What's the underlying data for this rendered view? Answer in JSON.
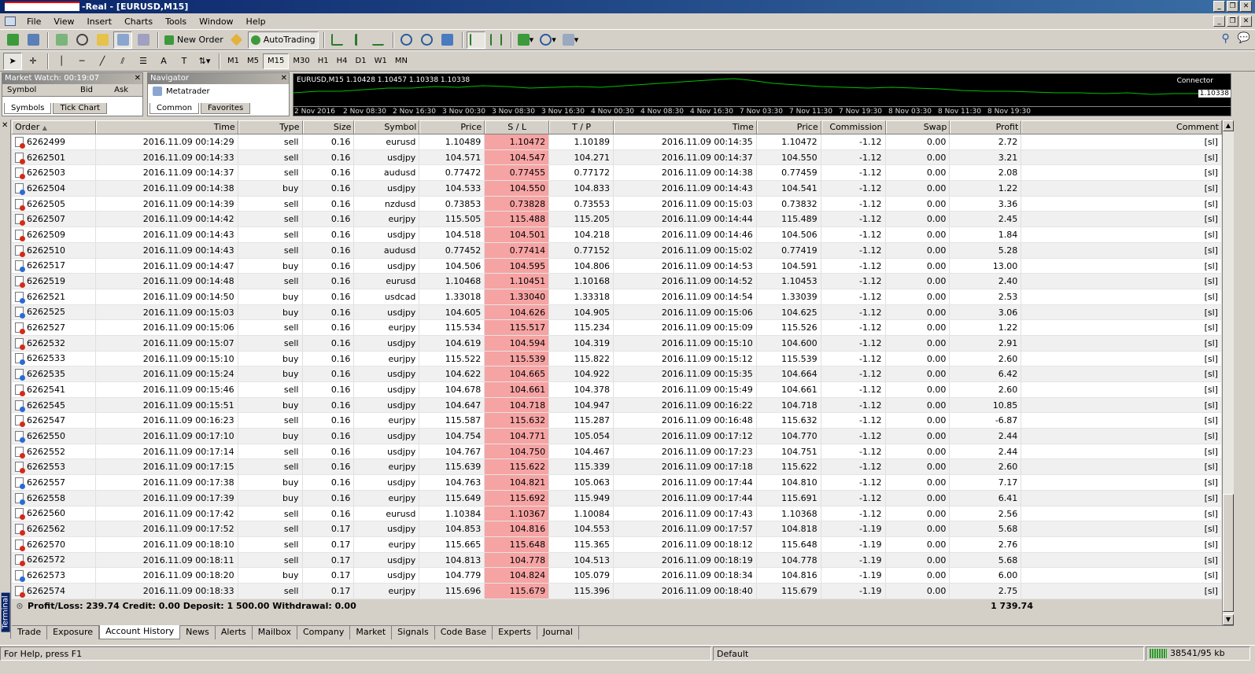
{
  "window": {
    "title": "-Real - [EURUSD,M15]"
  },
  "menu": [
    "File",
    "View",
    "Insert",
    "Charts",
    "Tools",
    "Window",
    "Help"
  ],
  "toolbar": {
    "new_order": "New Order",
    "autotrading": "AutoTrading"
  },
  "timeframes": [
    "M1",
    "M5",
    "M15",
    "M30",
    "H1",
    "H4",
    "D1",
    "W1",
    "MN"
  ],
  "active_timeframe": "M15",
  "market_watch": {
    "title": "Market Watch: 00:19:07",
    "cols": [
      "Symbol",
      "Bid",
      "Ask"
    ],
    "tabs": [
      "Symbols",
      "Tick Chart"
    ]
  },
  "navigator": {
    "title": "Navigator",
    "root": "Metatrader",
    "tabs": [
      "Common",
      "Favorites"
    ]
  },
  "chart": {
    "title": "EURUSD,M15  1.10428 1.10457 1.10338 1.10338",
    "connector": "Connector",
    "price": "1.10338",
    "ticks": [
      "2 Nov 2016",
      "2 Nov 08:30",
      "2 Nov 16:30",
      "3 Nov 00:30",
      "3 Nov 08:30",
      "3 Nov 16:30",
      "4 Nov 00:30",
      "4 Nov 08:30",
      "4 Nov 16:30",
      "7 Nov 03:30",
      "7 Nov 11:30",
      "7 Nov 19:30",
      "8 Nov 03:30",
      "8 Nov 11:30",
      "8 Nov 19:30"
    ]
  },
  "table": {
    "headers": [
      "Order",
      "Time",
      "Type",
      "Size",
      "Symbol",
      "Price",
      "S / L",
      "T / P",
      "Time",
      "Price",
      "Commission",
      "Swap",
      "Profit",
      "Comment"
    ],
    "rows": [
      [
        "6262499",
        "2016.11.09 00:14:29",
        "sell",
        "0.16",
        "eurusd",
        "1.10489",
        "1.10472",
        "1.10189",
        "2016.11.09 00:14:35",
        "1.10472",
        "-1.12",
        "0.00",
        "2.72",
        "[sl]"
      ],
      [
        "6262501",
        "2016.11.09 00:14:33",
        "sell",
        "0.16",
        "usdjpy",
        "104.571",
        "104.547",
        "104.271",
        "2016.11.09 00:14:37",
        "104.550",
        "-1.12",
        "0.00",
        "3.21",
        "[sl]"
      ],
      [
        "6262503",
        "2016.11.09 00:14:37",
        "sell",
        "0.16",
        "audusd",
        "0.77472",
        "0.77455",
        "0.77172",
        "2016.11.09 00:14:38",
        "0.77459",
        "-1.12",
        "0.00",
        "2.08",
        "[sl]"
      ],
      [
        "6262504",
        "2016.11.09 00:14:38",
        "buy",
        "0.16",
        "usdjpy",
        "104.533",
        "104.550",
        "104.833",
        "2016.11.09 00:14:43",
        "104.541",
        "-1.12",
        "0.00",
        "1.22",
        "[sl]"
      ],
      [
        "6262505",
        "2016.11.09 00:14:39",
        "sell",
        "0.16",
        "nzdusd",
        "0.73853",
        "0.73828",
        "0.73553",
        "2016.11.09 00:15:03",
        "0.73832",
        "-1.12",
        "0.00",
        "3.36",
        "[sl]"
      ],
      [
        "6262507",
        "2016.11.09 00:14:42",
        "sell",
        "0.16",
        "eurjpy",
        "115.505",
        "115.488",
        "115.205",
        "2016.11.09 00:14:44",
        "115.489",
        "-1.12",
        "0.00",
        "2.45",
        "[sl]"
      ],
      [
        "6262509",
        "2016.11.09 00:14:43",
        "sell",
        "0.16",
        "usdjpy",
        "104.518",
        "104.501",
        "104.218",
        "2016.11.09 00:14:46",
        "104.506",
        "-1.12",
        "0.00",
        "1.84",
        "[sl]"
      ],
      [
        "6262510",
        "2016.11.09 00:14:43",
        "sell",
        "0.16",
        "audusd",
        "0.77452",
        "0.77414",
        "0.77152",
        "2016.11.09 00:15:02",
        "0.77419",
        "-1.12",
        "0.00",
        "5.28",
        "[sl]"
      ],
      [
        "6262517",
        "2016.11.09 00:14:47",
        "buy",
        "0.16",
        "usdjpy",
        "104.506",
        "104.595",
        "104.806",
        "2016.11.09 00:14:53",
        "104.591",
        "-1.12",
        "0.00",
        "13.00",
        "[sl]"
      ],
      [
        "6262519",
        "2016.11.09 00:14:48",
        "sell",
        "0.16",
        "eurusd",
        "1.10468",
        "1.10451",
        "1.10168",
        "2016.11.09 00:14:52",
        "1.10453",
        "-1.12",
        "0.00",
        "2.40",
        "[sl]"
      ],
      [
        "6262521",
        "2016.11.09 00:14:50",
        "buy",
        "0.16",
        "usdcad",
        "1.33018",
        "1.33040",
        "1.33318",
        "2016.11.09 00:14:54",
        "1.33039",
        "-1.12",
        "0.00",
        "2.53",
        "[sl]"
      ],
      [
        "6262525",
        "2016.11.09 00:15:03",
        "buy",
        "0.16",
        "usdjpy",
        "104.605",
        "104.626",
        "104.905",
        "2016.11.09 00:15:06",
        "104.625",
        "-1.12",
        "0.00",
        "3.06",
        "[sl]"
      ],
      [
        "6262527",
        "2016.11.09 00:15:06",
        "sell",
        "0.16",
        "eurjpy",
        "115.534",
        "115.517",
        "115.234",
        "2016.11.09 00:15:09",
        "115.526",
        "-1.12",
        "0.00",
        "1.22",
        "[sl]"
      ],
      [
        "6262532",
        "2016.11.09 00:15:07",
        "sell",
        "0.16",
        "usdjpy",
        "104.619",
        "104.594",
        "104.319",
        "2016.11.09 00:15:10",
        "104.600",
        "-1.12",
        "0.00",
        "2.91",
        "[sl]"
      ],
      [
        "6262533",
        "2016.11.09 00:15:10",
        "buy",
        "0.16",
        "eurjpy",
        "115.522",
        "115.539",
        "115.822",
        "2016.11.09 00:15:12",
        "115.539",
        "-1.12",
        "0.00",
        "2.60",
        "[sl]"
      ],
      [
        "6262535",
        "2016.11.09 00:15:24",
        "buy",
        "0.16",
        "usdjpy",
        "104.622",
        "104.665",
        "104.922",
        "2016.11.09 00:15:35",
        "104.664",
        "-1.12",
        "0.00",
        "6.42",
        "[sl]"
      ],
      [
        "6262541",
        "2016.11.09 00:15:46",
        "sell",
        "0.16",
        "usdjpy",
        "104.678",
        "104.661",
        "104.378",
        "2016.11.09 00:15:49",
        "104.661",
        "-1.12",
        "0.00",
        "2.60",
        "[sl]"
      ],
      [
        "6262545",
        "2016.11.09 00:15:51",
        "buy",
        "0.16",
        "usdjpy",
        "104.647",
        "104.718",
        "104.947",
        "2016.11.09 00:16:22",
        "104.718",
        "-1.12",
        "0.00",
        "10.85",
        "[sl]"
      ],
      [
        "6262547",
        "2016.11.09 00:16:23",
        "sell",
        "0.16",
        "eurjpy",
        "115.587",
        "115.632",
        "115.287",
        "2016.11.09 00:16:48",
        "115.632",
        "-1.12",
        "0.00",
        "-6.87",
        "[sl]"
      ],
      [
        "6262550",
        "2016.11.09 00:17:10",
        "buy",
        "0.16",
        "usdjpy",
        "104.754",
        "104.771",
        "105.054",
        "2016.11.09 00:17:12",
        "104.770",
        "-1.12",
        "0.00",
        "2.44",
        "[sl]"
      ],
      [
        "6262552",
        "2016.11.09 00:17:14",
        "sell",
        "0.16",
        "usdjpy",
        "104.767",
        "104.750",
        "104.467",
        "2016.11.09 00:17:23",
        "104.751",
        "-1.12",
        "0.00",
        "2.44",
        "[sl]"
      ],
      [
        "6262553",
        "2016.11.09 00:17:15",
        "sell",
        "0.16",
        "eurjpy",
        "115.639",
        "115.622",
        "115.339",
        "2016.11.09 00:17:18",
        "115.622",
        "-1.12",
        "0.00",
        "2.60",
        "[sl]"
      ],
      [
        "6262557",
        "2016.11.09 00:17:38",
        "buy",
        "0.16",
        "usdjpy",
        "104.763",
        "104.821",
        "105.063",
        "2016.11.09 00:17:44",
        "104.810",
        "-1.12",
        "0.00",
        "7.17",
        "[sl]"
      ],
      [
        "6262558",
        "2016.11.09 00:17:39",
        "buy",
        "0.16",
        "eurjpy",
        "115.649",
        "115.692",
        "115.949",
        "2016.11.09 00:17:44",
        "115.691",
        "-1.12",
        "0.00",
        "6.41",
        "[sl]"
      ],
      [
        "6262560",
        "2016.11.09 00:17:42",
        "sell",
        "0.16",
        "eurusd",
        "1.10384",
        "1.10367",
        "1.10084",
        "2016.11.09 00:17:43",
        "1.10368",
        "-1.12",
        "0.00",
        "2.56",
        "[sl]"
      ],
      [
        "6262562",
        "2016.11.09 00:17:52",
        "sell",
        "0.17",
        "usdjpy",
        "104.853",
        "104.816",
        "104.553",
        "2016.11.09 00:17:57",
        "104.818",
        "-1.19",
        "0.00",
        "5.68",
        "[sl]"
      ],
      [
        "6262570",
        "2016.11.09 00:18:10",
        "sell",
        "0.17",
        "eurjpy",
        "115.665",
        "115.648",
        "115.365",
        "2016.11.09 00:18:12",
        "115.648",
        "-1.19",
        "0.00",
        "2.76",
        "[sl]"
      ],
      [
        "6262572",
        "2016.11.09 00:18:11",
        "sell",
        "0.17",
        "usdjpy",
        "104.813",
        "104.778",
        "104.513",
        "2016.11.09 00:18:19",
        "104.778",
        "-1.19",
        "0.00",
        "5.68",
        "[sl]"
      ],
      [
        "6262573",
        "2016.11.09 00:18:20",
        "buy",
        "0.17",
        "usdjpy",
        "104.779",
        "104.824",
        "105.079",
        "2016.11.09 00:18:34",
        "104.816",
        "-1.19",
        "0.00",
        "6.00",
        "[sl]"
      ],
      [
        "6262574",
        "2016.11.09 00:18:33",
        "sell",
        "0.17",
        "eurjpy",
        "115.696",
        "115.679",
        "115.396",
        "2016.11.09 00:18:40",
        "115.679",
        "-1.19",
        "0.00",
        "2.75",
        "[sl]"
      ]
    ],
    "summary": "Profit/Loss: 239.74  Credit: 0.00  Deposit: 1 500.00  Withdrawal: 0.00",
    "summary_profit": "1 739.74"
  },
  "terminal": {
    "label": "Terminal",
    "tabs": [
      "Trade",
      "Exposure",
      "Account History",
      "News",
      "Alerts",
      "Mailbox",
      "Company",
      "Market",
      "Signals",
      "Code Base",
      "Experts",
      "Journal"
    ],
    "selected_tab": "Account History"
  },
  "status": {
    "help": "For Help, press F1",
    "profile": "Default",
    "traffic": "38541/95 kb"
  },
  "colors": {
    "sl_highlight": "#f6a3a3",
    "sell_dot": "#d42a1a",
    "buy_dot": "#2a6ad4",
    "chart_line": "#00c000"
  }
}
